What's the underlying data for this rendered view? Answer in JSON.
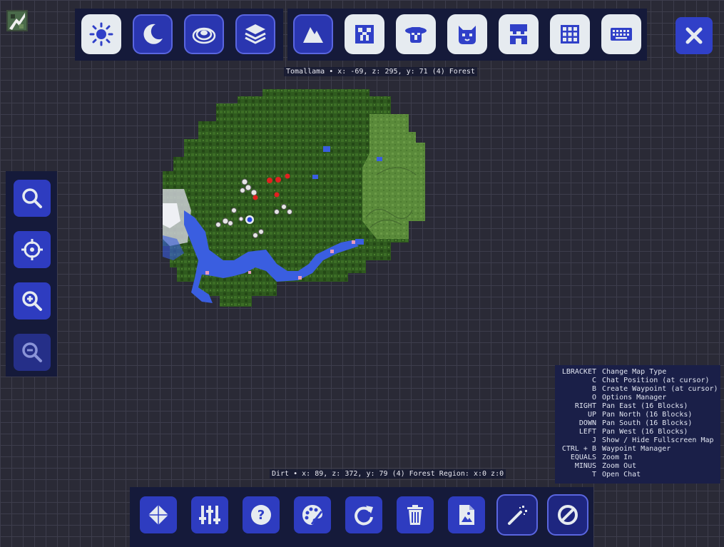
{
  "title_bar": {
    "logo_icon": "app-logo-icon"
  },
  "top_toolbar": {
    "buttons": [
      {
        "name": "day-map-button",
        "icon": "sun-icon",
        "style": "light"
      },
      {
        "name": "night-map-button",
        "icon": "moon-icon",
        "style": "dark"
      },
      {
        "name": "topo-map-button",
        "icon": "topo-icon",
        "style": "dark"
      },
      {
        "name": "layers-button",
        "icon": "layers-icon",
        "style": "dark"
      },
      {
        "name": "surface-button",
        "icon": "mountain-icon",
        "style": "dark"
      },
      {
        "name": "hostile-mobs-button",
        "icon": "creeper-icon",
        "style": "light"
      },
      {
        "name": "villagers-button",
        "icon": "villager-icon",
        "style": "light"
      },
      {
        "name": "pets-button",
        "icon": "cat-icon",
        "style": "light"
      },
      {
        "name": "players-button",
        "icon": "player-icon",
        "style": "light"
      },
      {
        "name": "grid-button",
        "icon": "grid-icon",
        "style": "light"
      },
      {
        "name": "keybindings-button",
        "icon": "keyboard-icon",
        "style": "light"
      }
    ],
    "close_icon": "close-icon"
  },
  "player_info": "Tomallama • x: -69, z: 295, y: 71 (4) Forest",
  "cursor_info": "Dirt • x: 89, z: 372, y: 79 (4) Forest Region: x:0 z:0",
  "side_toolbar": {
    "buttons": [
      {
        "name": "search-button",
        "icon": "search-icon"
      },
      {
        "name": "center-on-player-button",
        "icon": "crosshair-icon"
      },
      {
        "name": "zoom-in-button",
        "icon": "zoom-in-icon"
      },
      {
        "name": "zoom-out-button",
        "icon": "zoom-out-icon"
      }
    ]
  },
  "bottom_toolbar": {
    "buttons": [
      {
        "name": "waypoints-button",
        "icon": "waypoint-diamond-icon"
      },
      {
        "name": "options-button",
        "icon": "sliders-icon"
      },
      {
        "name": "help-button",
        "icon": "question-icon"
      },
      {
        "name": "theme-button",
        "icon": "palette-icon"
      },
      {
        "name": "refresh-button",
        "icon": "refresh-icon"
      },
      {
        "name": "delete-button",
        "icon": "trash-icon"
      },
      {
        "name": "export-button",
        "icon": "file-image-icon"
      },
      {
        "name": "auto-map-button",
        "icon": "magic-wand-icon"
      },
      {
        "name": "disable-button",
        "icon": "no-entry-icon"
      }
    ]
  },
  "keybindings": [
    {
      "key": "LBRACKET",
      "action": "Change Map Type"
    },
    {
      "key": "C",
      "action": "Chat Position (at cursor)"
    },
    {
      "key": "B",
      "action": "Create Waypoint (at cursor)"
    },
    {
      "key": "O",
      "action": "Options Manager"
    },
    {
      "key": "RIGHT",
      "action": "Pan East (16 Blocks)"
    },
    {
      "key": "UP",
      "action": "Pan North (16 Blocks)"
    },
    {
      "key": "DOWN",
      "action": "Pan South (16 Blocks)"
    },
    {
      "key": "LEFT",
      "action": "Pan West (16 Blocks)"
    },
    {
      "key": "J",
      "action": "Show / Hide Fullscreen Map"
    },
    {
      "key": "CTRL + B",
      "action": "Waypoint Manager"
    },
    {
      "key": "EQUALS",
      "action": "Zoom In"
    },
    {
      "key": "MINUS",
      "action": "Zoom Out"
    },
    {
      "key": "T",
      "action": "Open Chat"
    }
  ],
  "colors": {
    "panel": "#151a3a",
    "button_blue": "#3040c8",
    "button_light": "#e6ebf0",
    "forest": "#2d5a1c",
    "water": "#3a5ee0"
  }
}
